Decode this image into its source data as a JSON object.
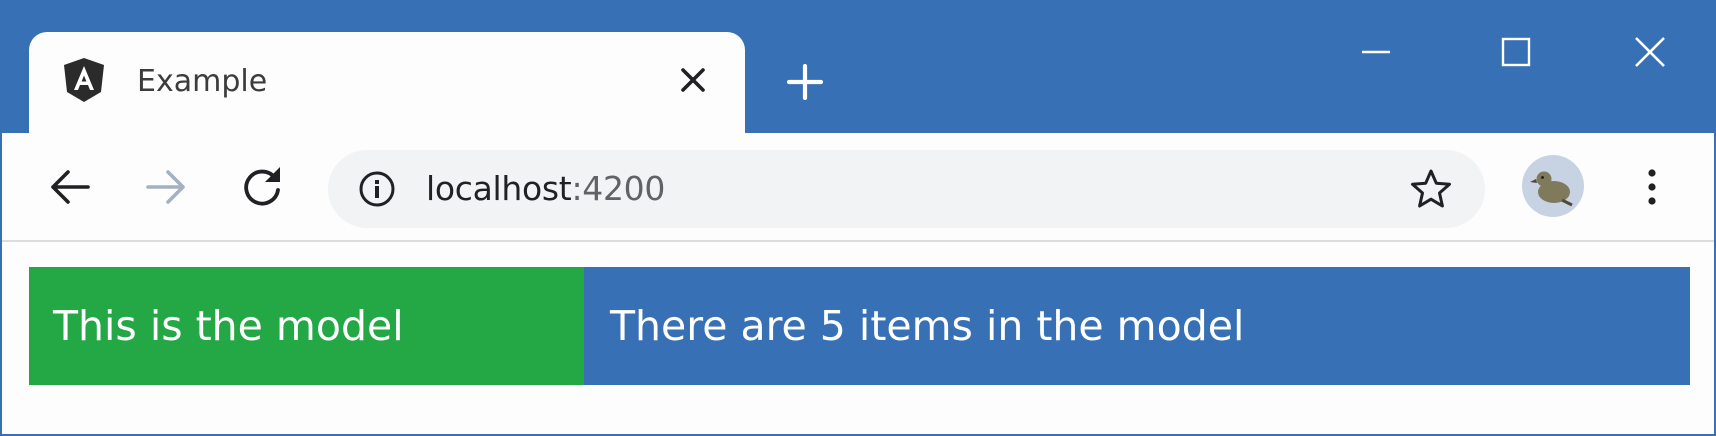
{
  "colors": {
    "titlebar": "#3870b5",
    "tab": "#fdfdfd",
    "omnibox": "#f1f3f4",
    "green_panel": "#24a846",
    "blue_panel": "#3870b5"
  },
  "tab": {
    "icon": "angular-icon",
    "title": "Example",
    "close_icon": "close-icon"
  },
  "titlebar": {
    "new_tab_icon": "plus-icon",
    "window_controls": [
      "minimize-icon",
      "maximize-icon",
      "close-icon"
    ]
  },
  "toolbar": {
    "back_icon": "arrow-left-icon",
    "forward_icon": "arrow-right-icon",
    "reload_icon": "reload-icon",
    "site_info_icon": "info-icon",
    "url_host": "localhost",
    "url_port": ":4200",
    "bookmark_icon": "star-icon",
    "profile_icon": "avatar-bird-icon",
    "menu_icon": "kebab-menu-icon"
  },
  "content": {
    "green_text": "This is the model",
    "blue_text": "There are 5 items in the model"
  }
}
